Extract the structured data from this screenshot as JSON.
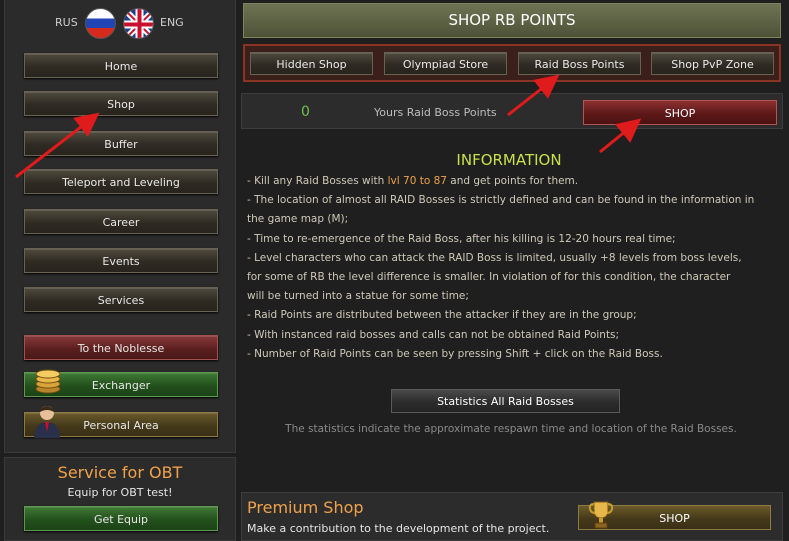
{
  "language": {
    "ru_label": "RUS",
    "en_label": "ENG"
  },
  "sidebar": {
    "items": [
      {
        "label": "Home"
      },
      {
        "label": "Shop"
      },
      {
        "label": "Buffer"
      },
      {
        "label": "Teleport and Leveling"
      },
      {
        "label": "Career"
      },
      {
        "label": "Events"
      },
      {
        "label": "Services"
      },
      {
        "label": "To the Noblesse"
      },
      {
        "label": "Exchanger"
      },
      {
        "label": "Personal Area"
      }
    ]
  },
  "obt": {
    "title": "Service for OBT",
    "subtitle": "Equip for OBT test!",
    "button": "Get Equip"
  },
  "main": {
    "title": "SHOP RB POINTS",
    "tabs": [
      {
        "label": "Hidden Shop"
      },
      {
        "label": "Olympiad Store"
      },
      {
        "label": "Raid Boss Points"
      },
      {
        "label": "Shop PvP Zone"
      }
    ],
    "points_value": "0",
    "points_label": "Yours Raid Boss Points",
    "shop_button": "SHOP",
    "info_title": "INFORMATION",
    "info": {
      "line1_pre": "- Kill any Raid Bosses with ",
      "line1_hl": "lvl 70 to 87",
      "line1_post": " and get points for them.",
      "line2": "- The location of almost all RAID Bosses is strictly defined and can be found in the information in",
      "line3": "the game map (M);",
      "line4": "- Time to re-emergence of the Raid Boss, after his killing is 12-20 hours real time;",
      "line5": "- Level characters who can attack the RAID Boss is limited, usually +8 levels from boss levels,",
      "line6": "for some of RB the level difference is smaller. In violation of for this condition, the character",
      "line7": "will be turned into a statue for some time;",
      "line8": "- Raid Points are distributed between the attacker if they are in the group;",
      "line9": "- With instanced raid bosses and calls can not be obtained Raid Points;",
      "line10": "- Number of Raid Points can be seen by pressing Shift + click on the Raid Boss."
    },
    "stats_button": "Statistics All Raid Bosses",
    "stats_note": "The statistics indicate the approximate respawn time and location of the Raid Bosses."
  },
  "premium": {
    "title": "Premium Shop",
    "subtitle": "Make a contribution to the development of the project.",
    "button": "SHOP"
  },
  "colors": {
    "accent_orange": "#f0a24a",
    "info_green": "#c8e04a",
    "arrow_red": "#e01b1b"
  }
}
